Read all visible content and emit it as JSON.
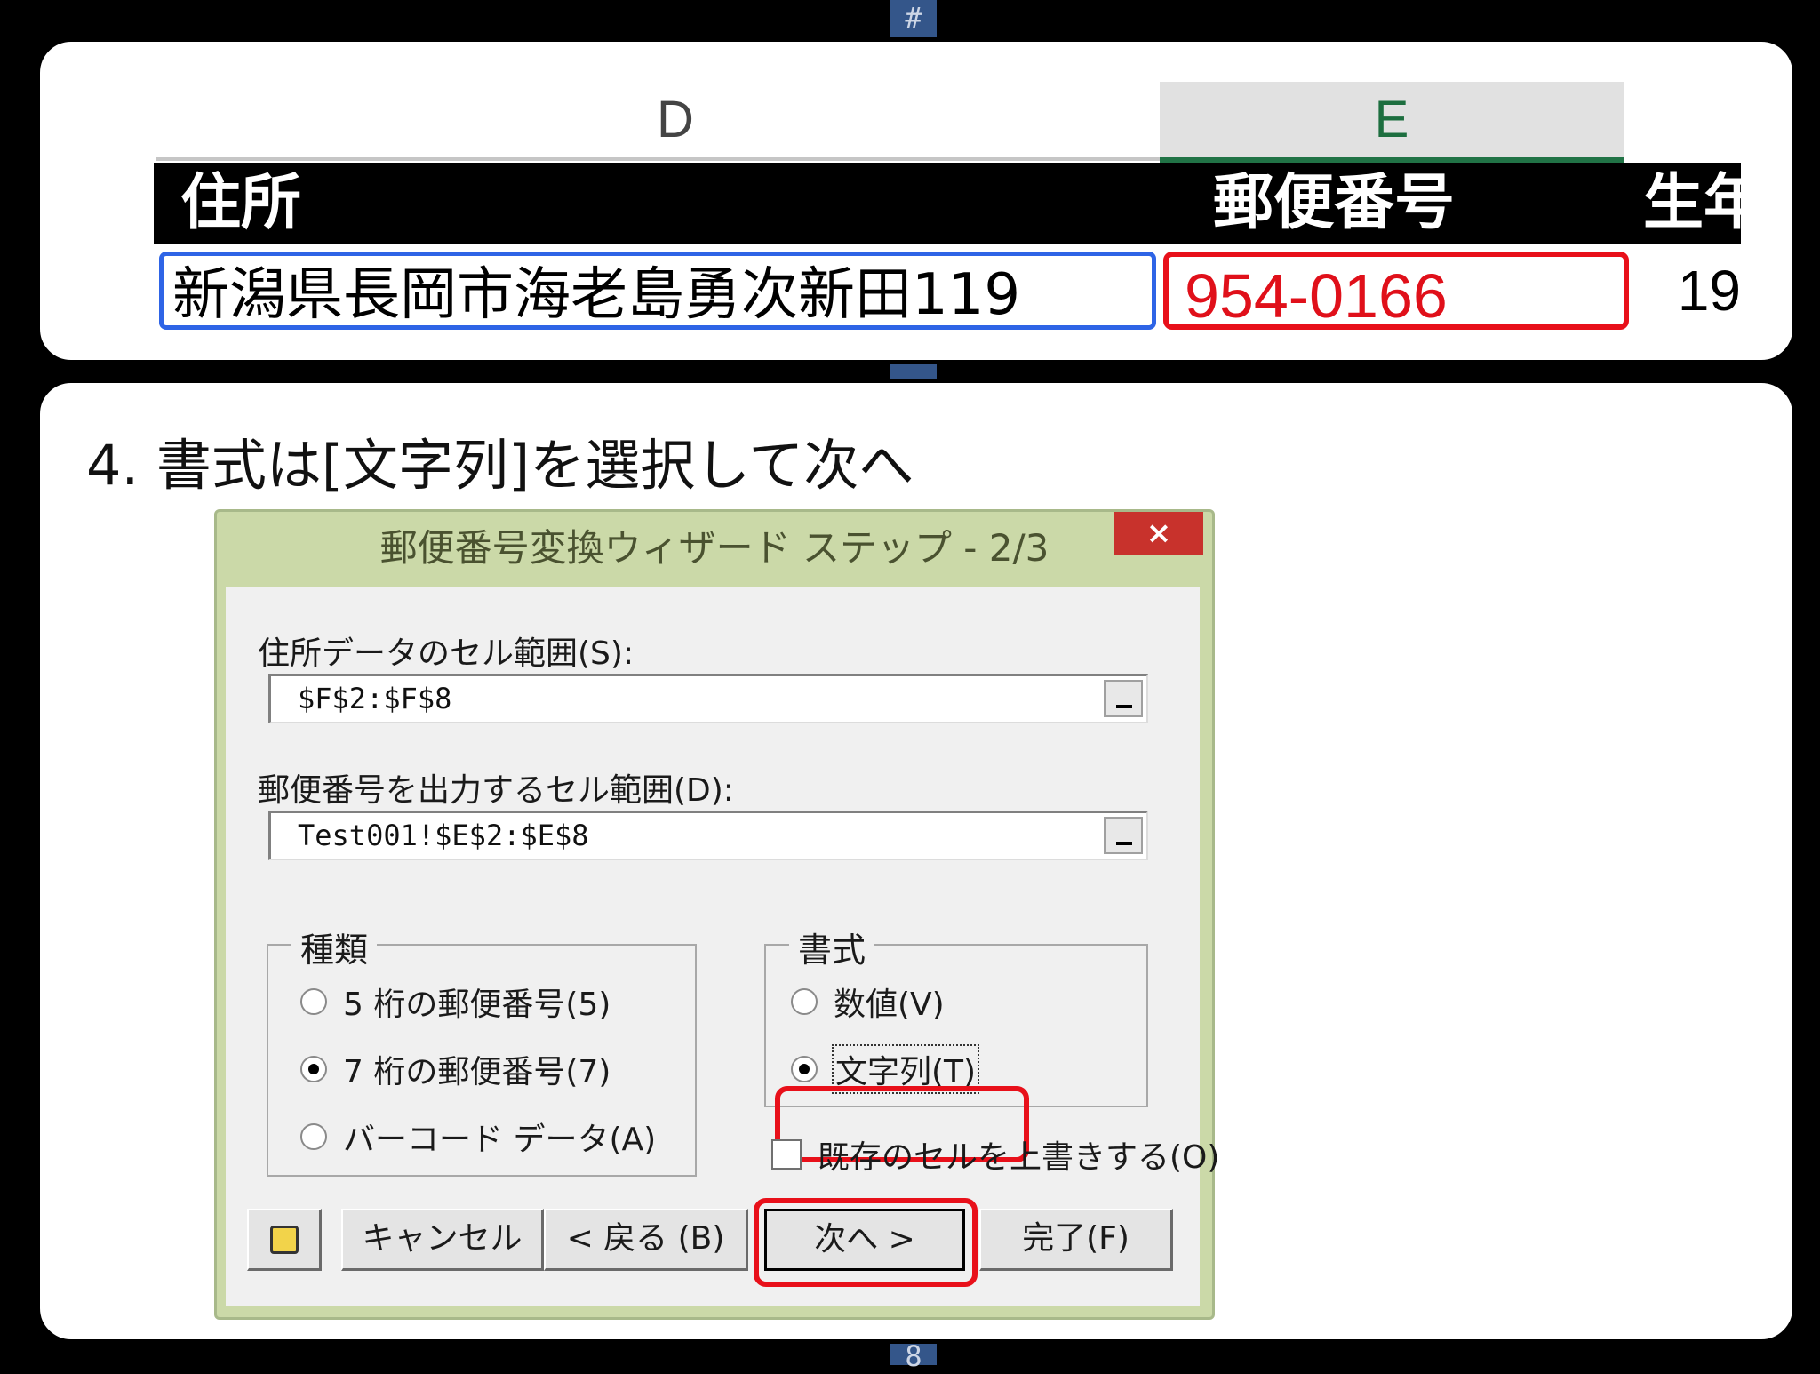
{
  "background_marks": {
    "top": "#",
    "bottom": "8"
  },
  "sheet": {
    "col_d": "D",
    "col_e": "E",
    "headers": {
      "address": "住所",
      "zip": "郵便番号",
      "birth": "生年"
    },
    "row": {
      "address": "新潟県長岡市海老島勇次新田119",
      "zip": "954-0166",
      "birth": "19"
    }
  },
  "instruction": "4. 書式は[文字列]を選択して次へ",
  "dialog": {
    "title": "郵便番号変換ウィザード ステップ - 2/3",
    "close_label": "×",
    "address_range_label": "住所データのセル範囲(S):",
    "address_range_value": "$F$2:$F$8",
    "output_range_label": "郵便番号を出力するセル範囲(D):",
    "output_range_value": "Test001!$E$2:$E$8",
    "type_group": {
      "title": "種類",
      "options": [
        "5 桁の郵便番号(5)",
        "7 桁の郵便番号(7)",
        "バーコード データ(A)"
      ],
      "selected": "7 桁の郵便番号(7)"
    },
    "format_group": {
      "title": "書式",
      "options": [
        "数値(V)",
        "文字列(T)"
      ],
      "selected": "文字列(T)"
    },
    "overwrite_label": "既存のセルを上書きする(O)",
    "overwrite_checked": false,
    "buttons": {
      "cancel": "キャンセル",
      "back": "< 戻る (B)",
      "next": "次へ >",
      "finish": "完了(F)"
    }
  },
  "colors": {
    "highlight": "#e8101a",
    "selection": "#2e64e6",
    "excel_green": "#217346",
    "title_bar": "#cbd9a8"
  }
}
